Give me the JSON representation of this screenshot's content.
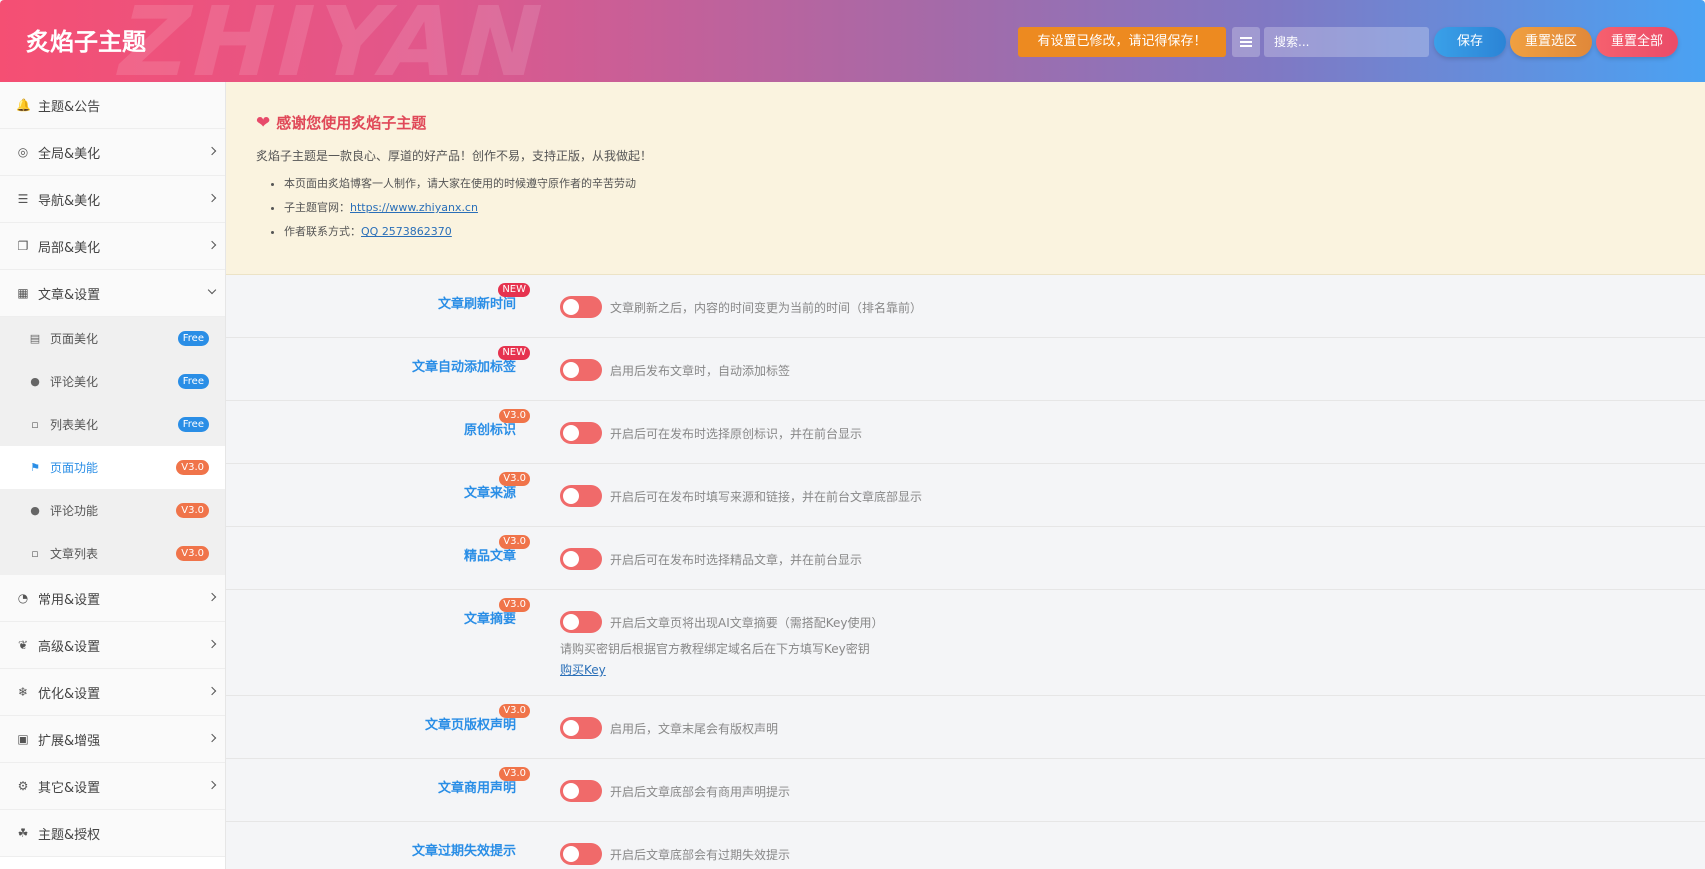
{
  "header": {
    "brand": "炙焰子主题",
    "watermark": "ZHIYAN",
    "notice": "有设置已修改，请记得保存！",
    "search_placeholder": "搜索...",
    "save": "保存",
    "reset_section": "重置选区",
    "reset_all": "重置全部"
  },
  "sidebar": {
    "items": [
      {
        "label": "主题&公告",
        "icon": "bell-icon"
      },
      {
        "label": "全局&美化",
        "icon": "target-icon"
      },
      {
        "label": "导航&美化",
        "icon": "list-icon"
      },
      {
        "label": "局部&美化",
        "icon": "copy-icon"
      },
      {
        "label": "文章&设置",
        "icon": "map-icon"
      }
    ],
    "sub_items": [
      {
        "label": "页面美化",
        "badge": "Free",
        "icon": "newspaper-icon"
      },
      {
        "label": "评论美化",
        "badge": "Free",
        "icon": "comments-icon"
      },
      {
        "label": "列表美化",
        "badge": "Free",
        "icon": "file-icon"
      },
      {
        "label": "页面功能",
        "badge": "V3.0",
        "icon": "bookmark-icon"
      },
      {
        "label": "评论功能",
        "badge": "V3.0",
        "icon": "comments-icon"
      },
      {
        "label": "文章列表",
        "badge": "V3.0",
        "icon": "file-icon"
      }
    ],
    "items_after": [
      {
        "label": "常用&设置",
        "icon": "pie-icon"
      },
      {
        "label": "高级&设置",
        "icon": "leaf-icon"
      },
      {
        "label": "优化&设置",
        "icon": "snowflake-icon"
      },
      {
        "label": "扩展&增强",
        "icon": "puzzle-icon"
      },
      {
        "label": "其它&设置",
        "icon": "gear-icon"
      },
      {
        "label": "主题&授权",
        "icon": "handshake-icon"
      }
    ]
  },
  "notice": {
    "title": "感谢您使用炙焰子主题",
    "subtitle": "炙焰子主题是一款良心、厚道的好产品！创作不易，支持正版，从我做起！",
    "line1": "本页面由炙焰博客一人制作，请大家在使用的时候遵守原作者的辛苦劳动",
    "line2_prefix": "子主题官网：",
    "line2_link": "https://www.zhiyanx.cn",
    "line3_prefix": "作者联系方式：",
    "line3_link": "QQ 2573862370"
  },
  "settings": [
    {
      "label": "文章刷新时间",
      "tag": "NEW",
      "desc": "文章刷新之后，内容的时间变更为当前的时间（排名靠前）"
    },
    {
      "label": "文章自动添加标签",
      "tag": "NEW",
      "desc": "启用后发布文章时，自动添加标签"
    },
    {
      "label": "原创标识",
      "tag": "V3.0",
      "desc": "开启后可在发布时选择原创标识，并在前台显示"
    },
    {
      "label": "文章来源",
      "tag": "V3.0",
      "desc": "开启后可在发布时填写来源和链接，并在前台文章底部显示"
    },
    {
      "label": "精品文章",
      "tag": "V3.0",
      "desc": "开启后可在发布时选择精品文章，并在前台显示"
    },
    {
      "label": "文章摘要",
      "tag": "V3.0",
      "desc": "开启后文章页将出现AI文章摘要（需搭配Key使用）",
      "extra": "请购买密钥后根据官方教程绑定域名后在下方填写Key密钥",
      "extra_link": "购买Key"
    },
    {
      "label": "文章页版权声明",
      "tag": "V3.0",
      "desc": "启用后，文章末尾会有版权声明"
    },
    {
      "label": "文章商用声明",
      "tag": "V3.0",
      "desc": "开启后文章底部会有商用声明提示"
    },
    {
      "label": "文章过期失效提示",
      "tag": "",
      "desc": "开启后文章底部会有过期失效提示"
    }
  ]
}
